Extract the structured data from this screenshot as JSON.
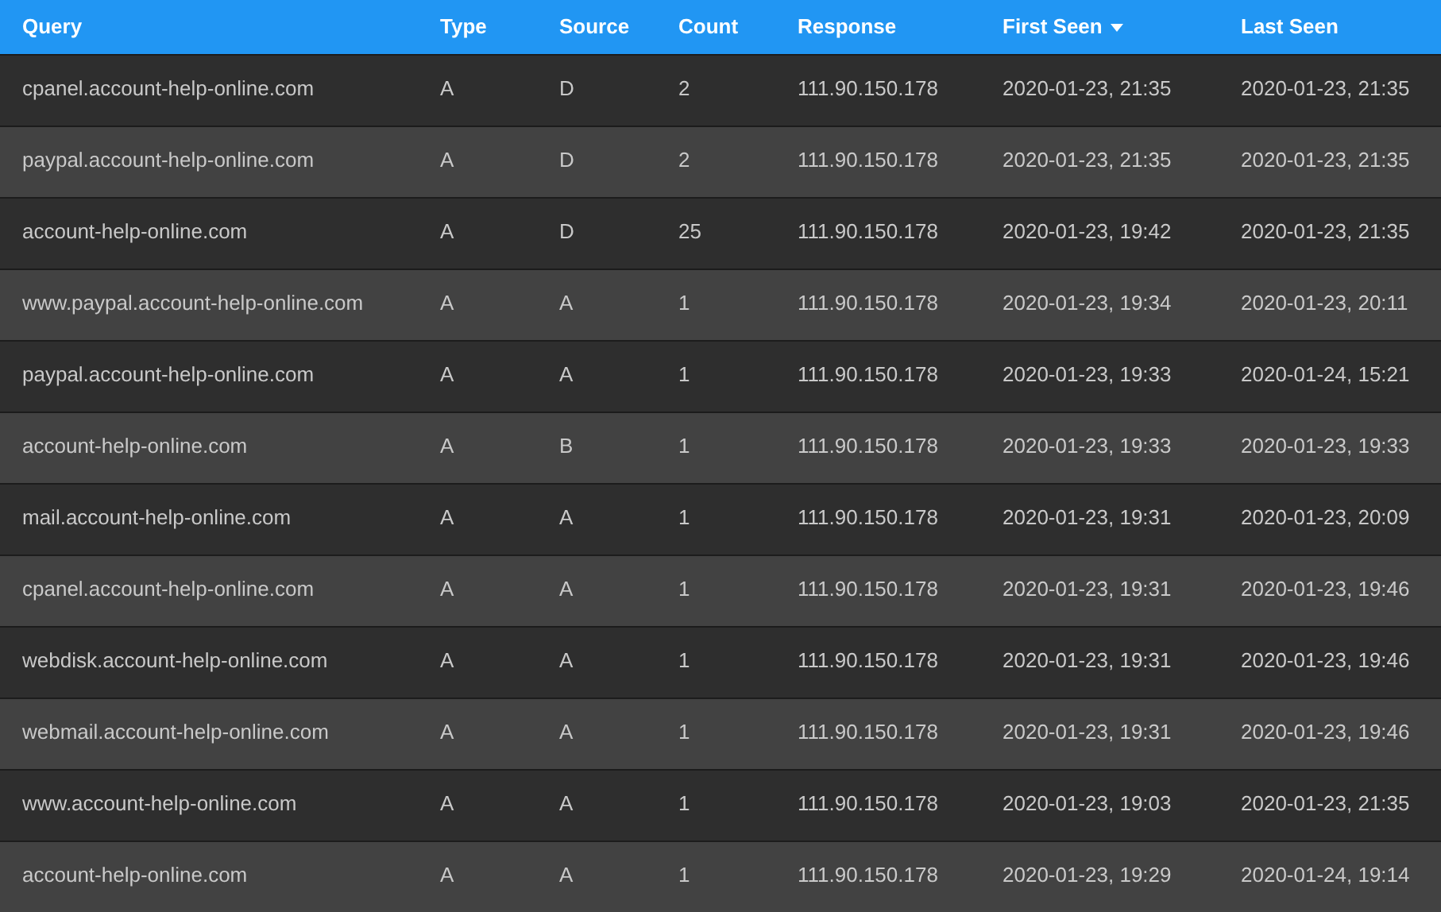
{
  "table": {
    "columns": [
      {
        "label": "Query",
        "sorted": false
      },
      {
        "label": "Type",
        "sorted": false
      },
      {
        "label": "Source",
        "sorted": false
      },
      {
        "label": "Count",
        "sorted": false
      },
      {
        "label": "Response",
        "sorted": false
      },
      {
        "label": "First Seen",
        "sorted": true
      },
      {
        "label": "Last Seen",
        "sorted": false
      }
    ],
    "rows": [
      [
        "cpanel.account-help-online.com",
        "A",
        "D",
        "2",
        "111.90.150.178",
        "2020-01-23, 21:35",
        "2020-01-23, 21:35"
      ],
      [
        "paypal.account-help-online.com",
        "A",
        "D",
        "2",
        "111.90.150.178",
        "2020-01-23, 21:35",
        "2020-01-23, 21:35"
      ],
      [
        "account-help-online.com",
        "A",
        "D",
        "25",
        "111.90.150.178",
        "2020-01-23, 19:42",
        "2020-01-23, 21:35"
      ],
      [
        "www.paypal.account-help-online.com",
        "A",
        "A",
        "1",
        "111.90.150.178",
        "2020-01-23, 19:34",
        "2020-01-23, 20:11"
      ],
      [
        "paypal.account-help-online.com",
        "A",
        "A",
        "1",
        "111.90.150.178",
        "2020-01-23, 19:33",
        "2020-01-24, 15:21"
      ],
      [
        "account-help-online.com",
        "A",
        "B",
        "1",
        "111.90.150.178",
        "2020-01-23, 19:33",
        "2020-01-23, 19:33"
      ],
      [
        "mail.account-help-online.com",
        "A",
        "A",
        "1",
        "111.90.150.178",
        "2020-01-23, 19:31",
        "2020-01-23, 20:09"
      ],
      [
        "cpanel.account-help-online.com",
        "A",
        "A",
        "1",
        "111.90.150.178",
        "2020-01-23, 19:31",
        "2020-01-23, 19:46"
      ],
      [
        "webdisk.account-help-online.com",
        "A",
        "A",
        "1",
        "111.90.150.178",
        "2020-01-23, 19:31",
        "2020-01-23, 19:46"
      ],
      [
        "webmail.account-help-online.com",
        "A",
        "A",
        "1",
        "111.90.150.178",
        "2020-01-23, 19:31",
        "2020-01-23, 19:46"
      ],
      [
        "www.account-help-online.com",
        "A",
        "A",
        "1",
        "111.90.150.178",
        "2020-01-23, 19:03",
        "2020-01-23, 21:35"
      ],
      [
        "account-help-online.com",
        "A",
        "A",
        "1",
        "111.90.150.178",
        "2020-01-23, 19:29",
        "2020-01-24, 19:14"
      ]
    ]
  }
}
